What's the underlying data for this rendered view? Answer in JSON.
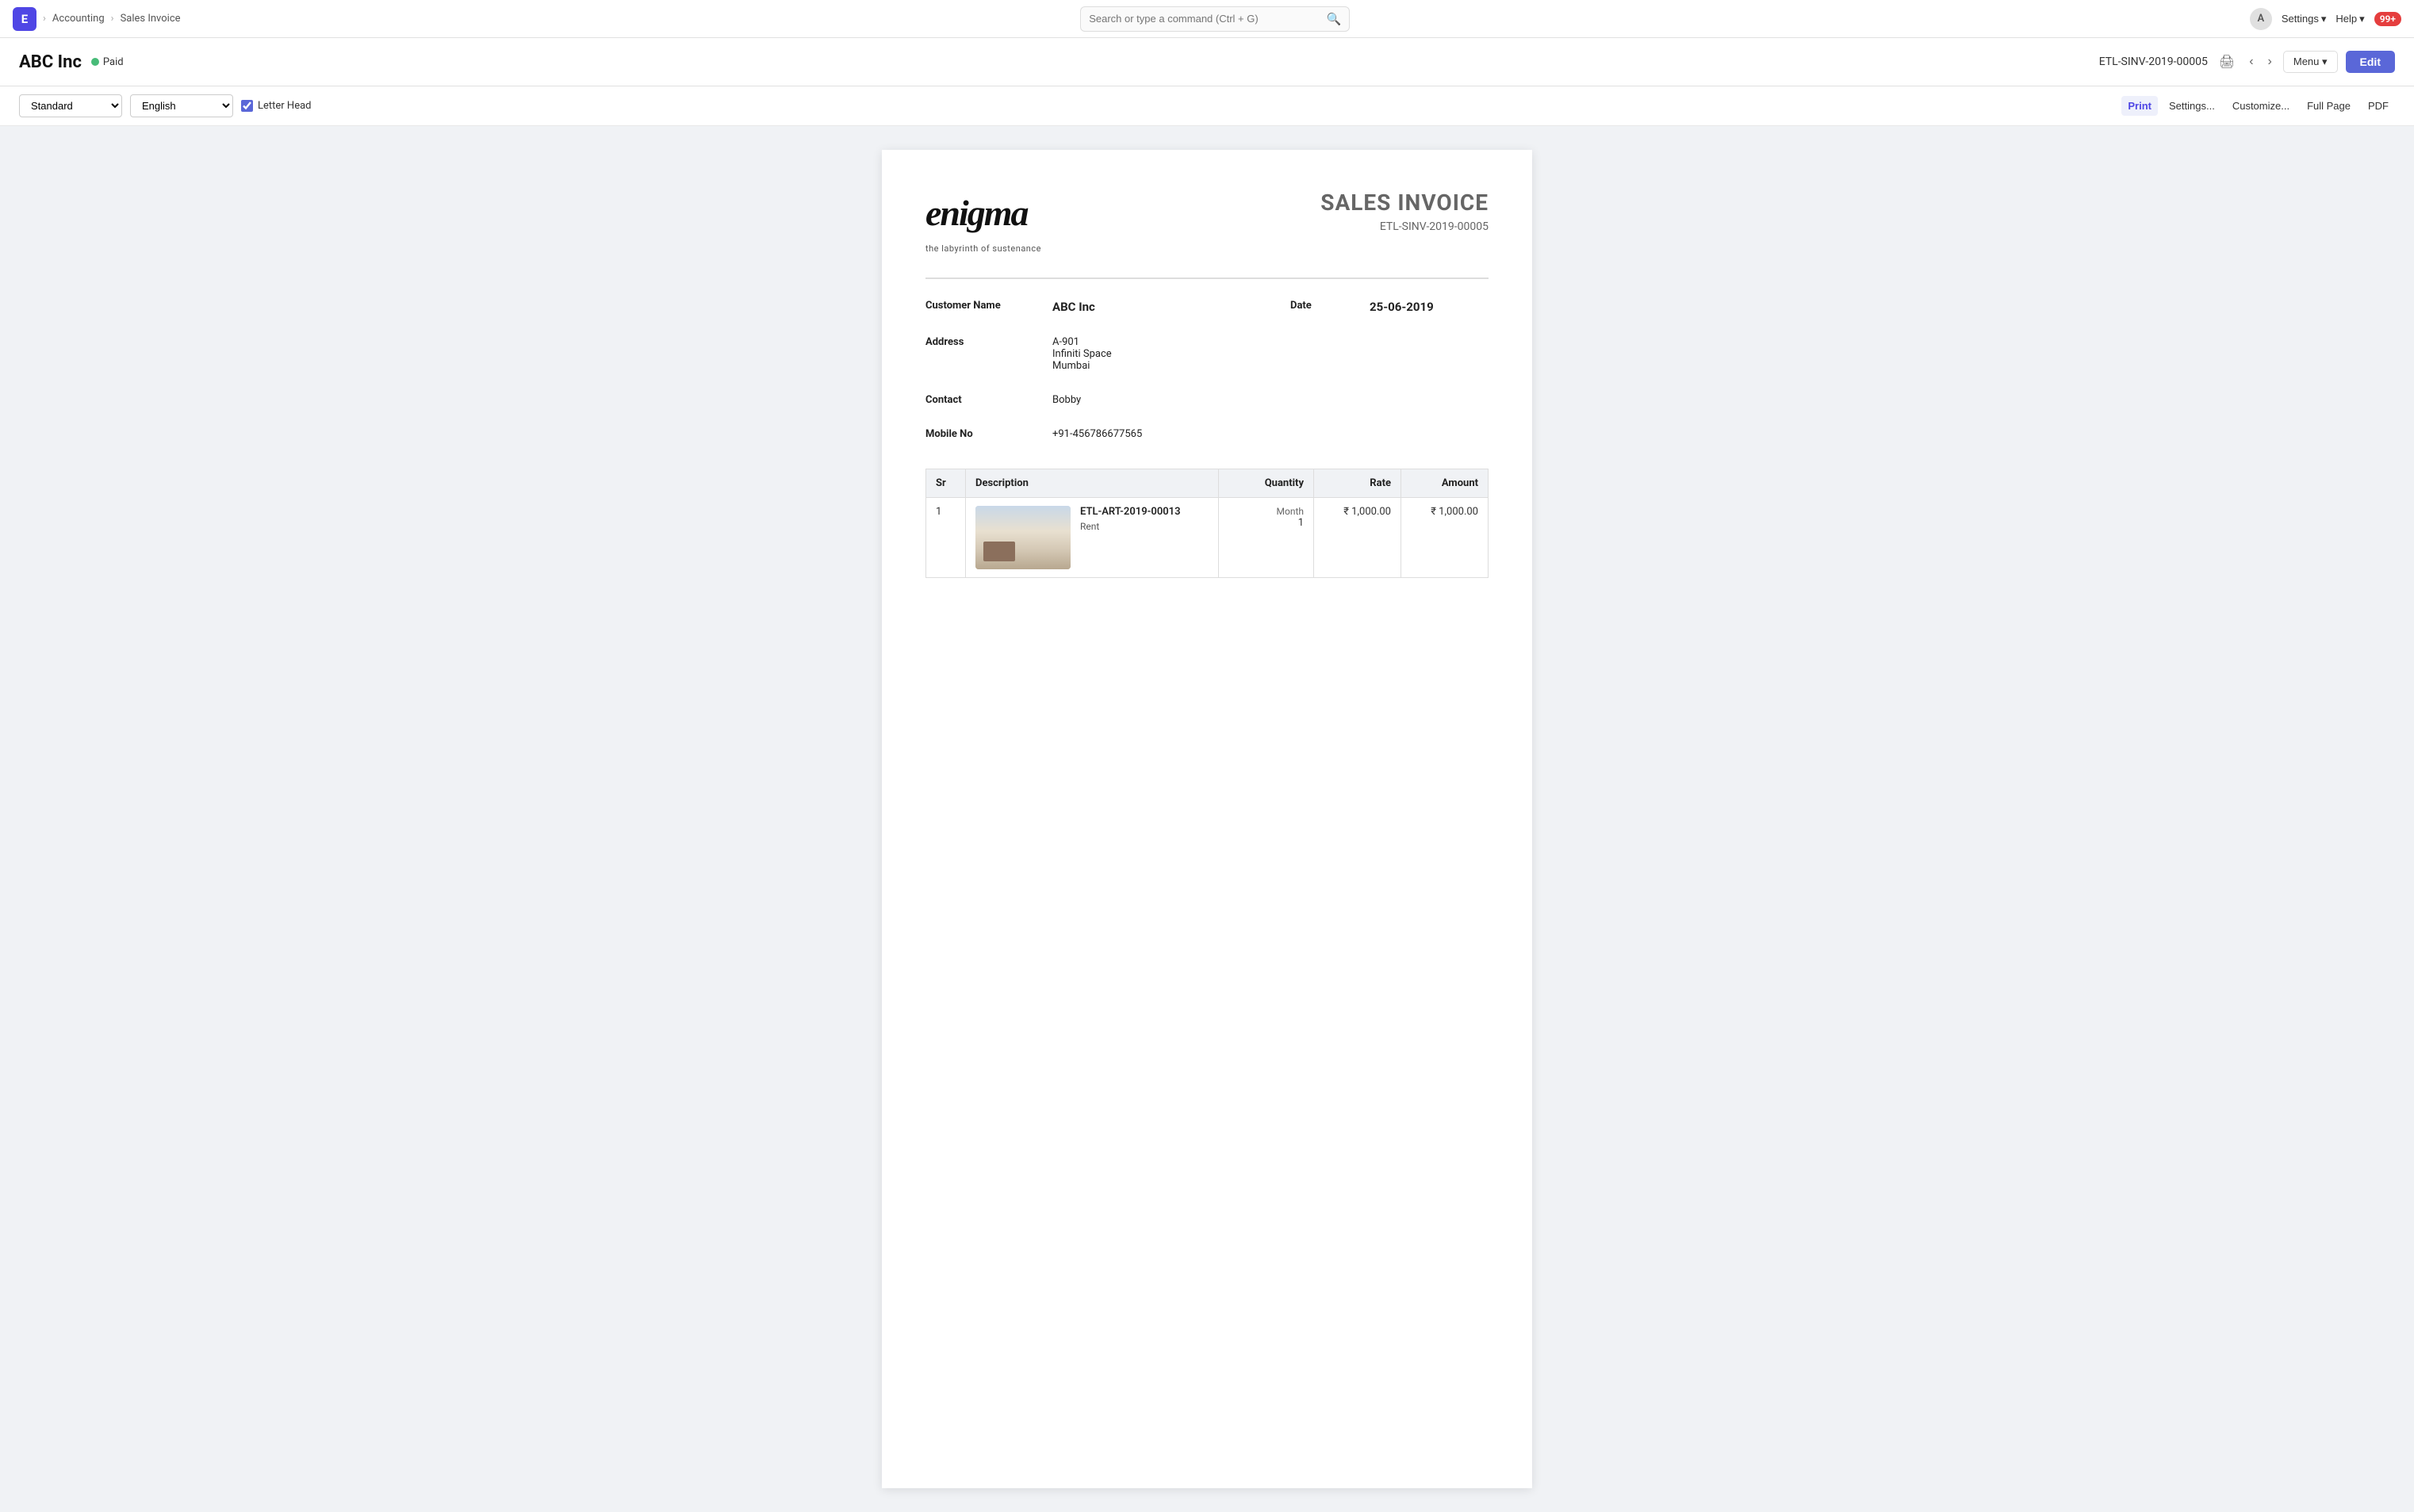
{
  "navbar": {
    "app_icon": "E",
    "breadcrumbs": [
      "Accounting",
      "Sales Invoice"
    ],
    "search_placeholder": "Search or type a command (Ctrl + G)",
    "avatar_label": "A",
    "settings_label": "Settings",
    "help_label": "Help",
    "notification_count": "99+"
  },
  "doc_header": {
    "title": "ABC Inc",
    "status": "Paid",
    "doc_id": "ETL-SINV-2019-00005",
    "menu_label": "Menu",
    "edit_label": "Edit"
  },
  "toolbar": {
    "format_option": "Standard",
    "language_option": "English",
    "letter_head_label": "Letter Head",
    "letter_head_checked": true,
    "print_label": "Print",
    "settings_label": "Settings...",
    "customize_label": "Customize...",
    "full_page_label": "Full Page",
    "pdf_label": "PDF"
  },
  "invoice": {
    "logo_text": "enigma",
    "logo_tagline": "the labyrinth of sustenance",
    "title": "SALES INVOICE",
    "invoice_number": "ETL-SINV-2019-00005",
    "customer_name_label": "Customer Name",
    "customer_name": "ABC Inc",
    "date_label": "Date",
    "date_value": "25-06-2019",
    "address_label": "Address",
    "address_line1": "A-901",
    "address_line2": "Infiniti Space",
    "address_line3": "Mumbai",
    "contact_label": "Contact",
    "contact_value": "Bobby",
    "mobile_label": "Mobile No",
    "mobile_value": "+91-456786677565",
    "table": {
      "col_sr": "Sr",
      "col_description": "Description",
      "col_quantity": "Quantity",
      "col_rate": "Rate",
      "col_amount": "Amount",
      "rows": [
        {
          "sr": "1",
          "item_code": "ETL-ART-2019-00013",
          "item_name": "Rent",
          "unit": "Month",
          "quantity": "1",
          "rate": "₹ 1,000.00",
          "amount": "₹ 1,000.00"
        }
      ]
    }
  }
}
